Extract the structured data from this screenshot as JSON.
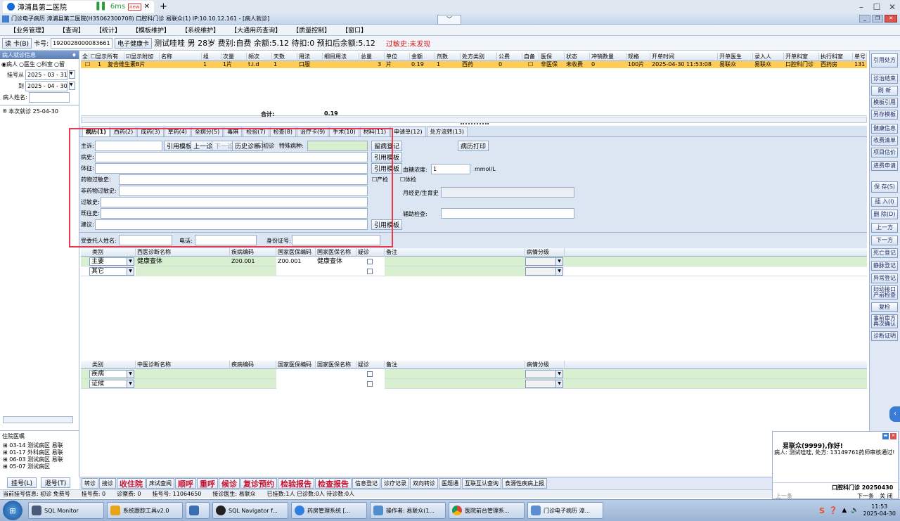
{
  "browser": {
    "tab_title": "漳浦县第二医院",
    "ping": "6ms",
    "ping_badge": "new",
    "new_tab": "+"
  },
  "app": {
    "title": "门诊电子病历 漳浦县第二医院(H35062300708) 口腔科门诊 易联众(1) IP:10.10.12.161 - [病人就诊]",
    "menus": [
      "【业务管理】",
      "【查询】",
      "【统计】",
      "【模板维护】",
      "【系统维护】",
      "【大通用药查询】",
      "【质量控制】",
      "【窗口】"
    ]
  },
  "cardbar": {
    "read_card": "读 卡(B)",
    "card_no_label": "卡号:",
    "card_no": "1920028000083661",
    "ehealth": "电子健康卡",
    "patient_info": "测试哇哇 男 28岁 费别:自费 余额:5.12 待扣:0 预扣后余额:5.12",
    "allergy": "过敏史:未发现"
  },
  "left": {
    "header": "病人就诊信息",
    "radios": [
      "病人",
      "医生",
      "科室",
      "留"
    ],
    "reg_from_label": "挂号从",
    "reg_from": "2025 - 03 - 31",
    "reg_to_label": "到",
    "reg_to": "2025 - 04 - 30",
    "name_label": "病人姓名:",
    "tree_item": "本次就诊 25-04-30",
    "ward_header": "住院医嘱",
    "ward_items": [
      "03-14 测试病区 易联",
      "01-17 外科病区 易联",
      "06-03 测试病区 易联",
      "05-07 测试病区"
    ],
    "btn_reg": "挂号(L)",
    "btn_unreg": "退号(T)"
  },
  "grid": {
    "headers": [
      "全",
      "显示所有",
      "显示附加",
      "名称",
      "组",
      "次量",
      "频次",
      "天数",
      "用法",
      "细目用法",
      "总量",
      "单位",
      "金额",
      "剂数",
      "处方类别",
      "公费",
      "自备",
      "医保",
      "状态",
      "冲销数量",
      "规格",
      "开单时间",
      "开单医生",
      "录入人",
      "开单科室",
      "执行科室",
      "单号"
    ],
    "row": {
      "no": "1",
      "name": "复合维生素B片",
      "group": "1",
      "dose": "1片",
      "freq": "t.i.d",
      "days": "1",
      "usage": "口服",
      "total": "3",
      "unit": "片",
      "amount": "0.19",
      "doses": "1",
      "rx_type": "西药",
      "public": "0",
      "insurance": "非医保",
      "status": "未收费",
      "refund": "0",
      "spec": "100片",
      "time": "2025-04-30 11:53:08",
      "doctor": "易联众",
      "entry": "易联众",
      "dept": "口腔科门诊",
      "exec": "西药房",
      "rx_no": "131"
    },
    "sum_label": "合计:",
    "sum_value": "0.19"
  },
  "right_buttons": [
    "引用处方",
    "诊治结束",
    "刷 新",
    "模板引用",
    "另存模板",
    "健康信息",
    "收费清单",
    "项目估价",
    "进费申请",
    "保 存(S)",
    "插 入(I)",
    "删 除(D)",
    "上一方",
    "下一方",
    "死亡登记",
    "静脉登记",
    "异常登记",
    "妇幼接口产前检查",
    "复检",
    "事前审方再次确认",
    "诊断证明"
  ],
  "tabs": [
    "病历(1)",
    "西药(2)",
    "成药(3)",
    "草药(4)",
    "全病分(5)",
    "毒麻",
    "检验(7)",
    "检查(8)",
    "治疗卡(9)",
    "手术(10)",
    "材料(11)",
    "申请单(12)",
    "处方流转(13)"
  ],
  "form": {
    "chief": "主诉:",
    "btn_tpl": "引用模板",
    "btn_prev": "上一诊",
    "btn_next": "下一诊",
    "btn_history": "历史诊断",
    "first_visit": "初诊",
    "special": "特殊病种:",
    "btn_leave": "留病登记",
    "btn_print": "病历打印",
    "history": "病史:",
    "sign": "体征:",
    "drug_allergy": "药物过敏史:",
    "non_drug_allergy": "非药物过敏史:",
    "allergy": "过敏史:",
    "past": "既往史:",
    "advice": "建议:",
    "btn_ref1": "引用模板",
    "btn_ref2": "引用模板",
    "btn_ref3": "引用模板",
    "prenatal": "产检",
    "physical": "体检",
    "glucose_label": "血糖浓度:",
    "glucose_value": "1",
    "glucose_unit": "mmol/L",
    "menstrual": "月经史/生育史",
    "aux_exam": "辅助检查:",
    "agent_name": "受委托人姓名:",
    "phone": "电话:",
    "id_no": "身份证号:"
  },
  "diag_west": {
    "headers": [
      "类别",
      "西医诊断名称",
      "疾病编码",
      "国家医保编码",
      "国家医保名称",
      "疑诊",
      "备注",
      "病情分级"
    ],
    "rows": [
      {
        "category": "主要",
        "name": "健康查体",
        "code": "Z00.001",
        "nat_code": "Z00.001",
        "nat_name": "健康查体"
      },
      {
        "category": "其它",
        "name": "",
        "code": "",
        "nat_code": "",
        "nat_name": ""
      }
    ]
  },
  "diag_tcm": {
    "headers": [
      "类别",
      "中医诊断名称",
      "疾病编码",
      "国家医保编码",
      "国家医保名称",
      "疑诊",
      "备注",
      "病情分级"
    ],
    "rows": [
      {
        "category": "疾病"
      },
      {
        "category": "证候"
      }
    ]
  },
  "actions": [
    {
      "label": "转诊",
      "big": false
    },
    {
      "label": "接诊",
      "big": false
    },
    {
      "label": "收住院",
      "big": true
    },
    {
      "label": "床试查阅",
      "big": false
    },
    {
      "label": "顺呼",
      "big": true
    },
    {
      "label": "重呼",
      "big": true
    },
    {
      "label": "候诊",
      "big": true
    },
    {
      "label": "复诊预约",
      "big": true
    },
    {
      "label": "检验报告",
      "big": true
    },
    {
      "label": "检查报告",
      "big": true
    },
    {
      "label": "信息登记",
      "big": false
    },
    {
      "label": "诊疗记录",
      "big": false
    },
    {
      "label": "双向转诊",
      "big": false
    },
    {
      "label": "医题通",
      "big": false
    },
    {
      "label": "互联互认查询",
      "big": false
    },
    {
      "label": "食源性疾病上报",
      "big": false
    }
  ],
  "status": {
    "current": "当前挂号信息: 初诊 免费号",
    "reg_count": "挂号费: 0",
    "diag_fee": "诊察费: 0",
    "reg_no": "挂号号: 11064650",
    "doctor": "接诊医生: 易联众",
    "queue": "已挂数:1人 已诊数:0人 待诊数:0人"
  },
  "notify": {
    "title": "易联众(9999),你好!",
    "message": "病人: 测试哇哇, 处方: 13149761药师审核通过!",
    "prev": "上一条",
    "next": "下一条",
    "close": "关 闭",
    "footer": "口腔科门诊 20250430"
  },
  "taskbar": {
    "items": [
      "SQL Monitor",
      "系统跟踪工具v2.0",
      "",
      "SQL Navigator f...",
      "药房管理系统 [...",
      "操作者: 易联众(1...",
      "医院前台管理系...",
      "门诊电子病历 漳..."
    ],
    "time": "11:53",
    "date": "2025-04-30"
  }
}
